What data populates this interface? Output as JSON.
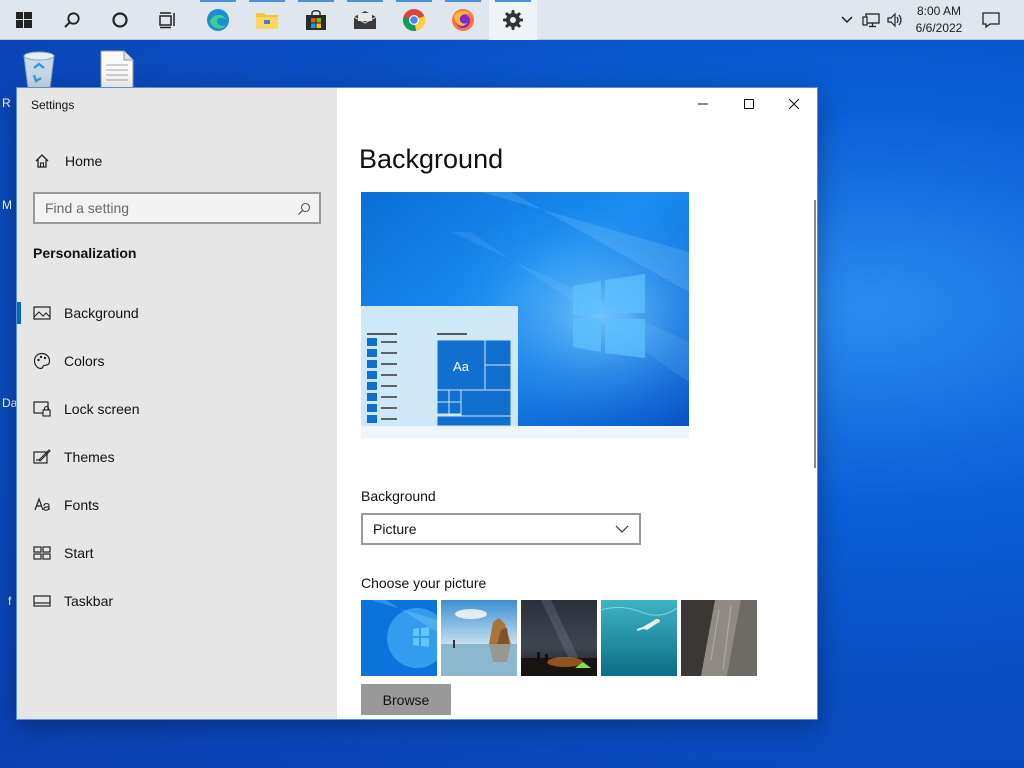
{
  "taskbar": {
    "clock_time": "8:00 AM",
    "clock_date": "6/6/2022",
    "apps": [
      "start-icon",
      "search-icon",
      "cortana-icon",
      "task-view-icon",
      "edge-icon",
      "file-explorer-icon",
      "store-icon",
      "mail-icon",
      "chrome-icon",
      "firefox-icon",
      "settings-icon"
    ]
  },
  "desktop": {
    "edge_labels": [
      "R",
      "M",
      "Da",
      "f"
    ]
  },
  "window": {
    "title": "Settings",
    "controls": [
      "minimize-icon",
      "maximize-icon",
      "close-icon"
    ]
  },
  "sidebar": {
    "home_label": "Home",
    "search_placeholder": "Find a setting",
    "section_title": "Personalization",
    "items": [
      {
        "label": "Background",
        "icon": "picture-icon",
        "selected": true
      },
      {
        "label": "Colors",
        "icon": "palette-icon"
      },
      {
        "label": "Lock screen",
        "icon": "lock-screen-icon"
      },
      {
        "label": "Themes",
        "icon": "themes-icon"
      },
      {
        "label": "Fonts",
        "icon": "fonts-icon"
      },
      {
        "label": "Start",
        "icon": "start-layout-icon"
      },
      {
        "label": "Taskbar",
        "icon": "taskbar-icon"
      }
    ]
  },
  "main": {
    "title": "Background",
    "preview_tile_text": "Aa",
    "background_label": "Background",
    "background_value": "Picture",
    "choose_label": "Choose your picture",
    "thumbnails": [
      "windows-light-wallpaper",
      "beach-rocks-wallpaper",
      "night-sky-tent-wallpaper",
      "underwater-swimmer-wallpaper",
      "rock-cliff-wallpaper"
    ],
    "browse_label": "Browse"
  },
  "colors": {
    "accent": "#0067c0",
    "sidebar_bg": "#e6e6e6",
    "desktop_blue": "#0a5fd6"
  }
}
